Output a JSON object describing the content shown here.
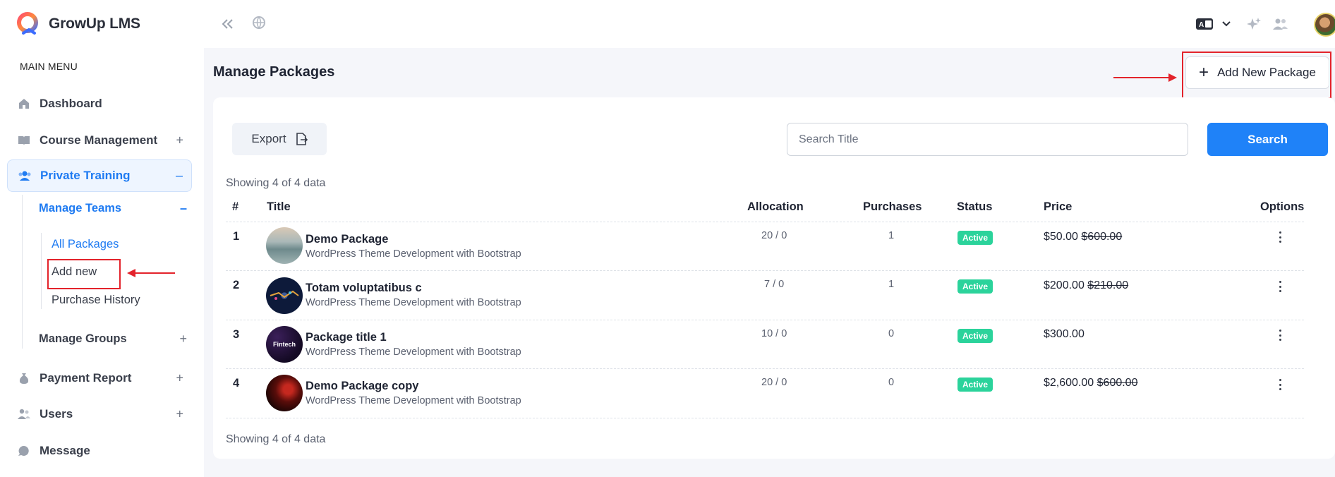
{
  "brand": {
    "name": "GrowUp LMS"
  },
  "sidebar": {
    "menu_title": "MAIN MENU",
    "items": [
      {
        "label": "Dashboard",
        "icon": "home-icon"
      },
      {
        "label": "Course Management",
        "icon": "book-icon",
        "toggle": "+"
      },
      {
        "label": "Private Training",
        "icon": "users-icon",
        "toggle": "–",
        "active": true
      },
      {
        "label": "Payment Report",
        "icon": "money-bag-icon",
        "toggle": "+"
      },
      {
        "label": "Users",
        "icon": "user-group-icon",
        "toggle": "+"
      },
      {
        "label": "Message",
        "icon": "chat-icon"
      }
    ],
    "manage_teams": {
      "label": "Manage Teams",
      "toggle": "–"
    },
    "sub_items": [
      {
        "label": "All Packages"
      },
      {
        "label": "Add new"
      },
      {
        "label": "Purchase History"
      }
    ],
    "manage_groups": {
      "label": "Manage Groups",
      "toggle": "+"
    }
  },
  "topbar": {
    "icons": [
      "collapse-sidebar-icon",
      "globe-icon",
      "language-icon",
      "chevron-down-icon",
      "sparkle-icon",
      "users-icon",
      "avatar"
    ]
  },
  "main": {
    "title": "Manage Packages",
    "add_button": "Add New Package",
    "export_button": "Export",
    "search": {
      "placeholder": "Search Title",
      "value": ""
    },
    "search_button": "Search",
    "showing_text": "Showing 4 of 4 data",
    "columns": [
      "#",
      "Title",
      "Allocation",
      "Purchases",
      "Status",
      "Price",
      "Options"
    ],
    "rows": [
      {
        "num": "1",
        "title": "Demo Package",
        "subtitle": "WordPress Theme Development with Bootstrap",
        "allocation": "20 / 0",
        "purchases": "1",
        "status": "Active",
        "price": "$50.00",
        "old_price": "$600.00"
      },
      {
        "num": "2",
        "title": "Totam voluptatibus c",
        "subtitle": "WordPress Theme Development with Bootstrap",
        "allocation": "7 / 0",
        "purchases": "1",
        "status": "Active",
        "price": "$200.00",
        "old_price": "$210.00"
      },
      {
        "num": "3",
        "title": "Package title 1",
        "subtitle": "WordPress Theme Development with Bootstrap",
        "allocation": "10 / 0",
        "purchases": "0",
        "status": "Active",
        "price": "$300.00",
        "old_price": "",
        "thumb_text": "Fintech"
      },
      {
        "num": "4",
        "title": "Demo Package copy",
        "subtitle": "WordPress Theme Development with Bootstrap",
        "allocation": "20 / 0",
        "purchases": "0",
        "status": "Active",
        "price": "$2,600.00",
        "old_price": "$600.00"
      }
    ]
  },
  "colors": {
    "accent": "#1f82f8",
    "active_badge": "#2bd39b",
    "annotation": "#e3232b"
  }
}
